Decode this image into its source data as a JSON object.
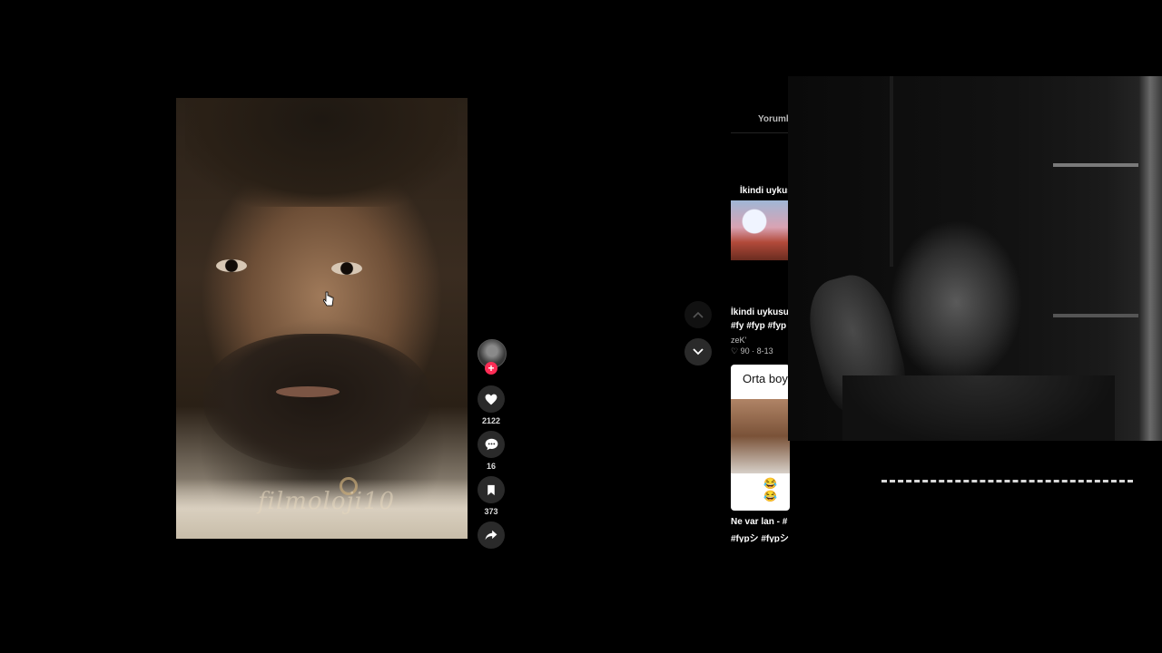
{
  "video": {
    "watermark": "filmoloji10"
  },
  "actions": {
    "likes": "2122",
    "comments": "16",
    "saves": "373",
    "follow_symbol": "+"
  },
  "panel": {
    "tab_label": "Yoruml",
    "item1_title": "İkindi uykus",
    "item1_caption_line1": "İkindi uykusu",
    "item1_caption_line2": "#fy #fyp #fyp",
    "item1_author": "zeK'",
    "item1_meta": "♡ 90 · 8-13",
    "item2_thumb_title": "Orta boy",
    "item2_thumb_emoji": "😂😂",
    "item2_caption_line1": "Ne var lan - #",
    "item2_caption_line2": "#fypシ #fypシ"
  },
  "colors": {
    "background": "#000000",
    "follow_badge": "#fe2c55"
  }
}
